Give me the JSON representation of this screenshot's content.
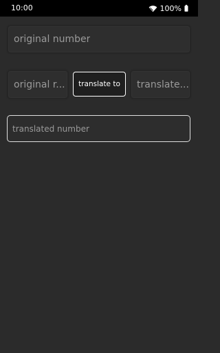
{
  "status_bar": {
    "time": "10:00",
    "battery": "100%",
    "wifi_icon": "wifi-icon",
    "battery_icon": "battery-icon"
  },
  "inputs": {
    "original_number_placeholder": "original number",
    "from_language": "original r...",
    "to_language": "translate...",
    "translated_number_placeholder": "translated number"
  },
  "actions": {
    "translate_label": "translate to"
  },
  "colors": {
    "background": "#2b2b2b",
    "status_bar": "#000000",
    "text": "#ffffff",
    "placeholder": "#9a9a9a"
  }
}
